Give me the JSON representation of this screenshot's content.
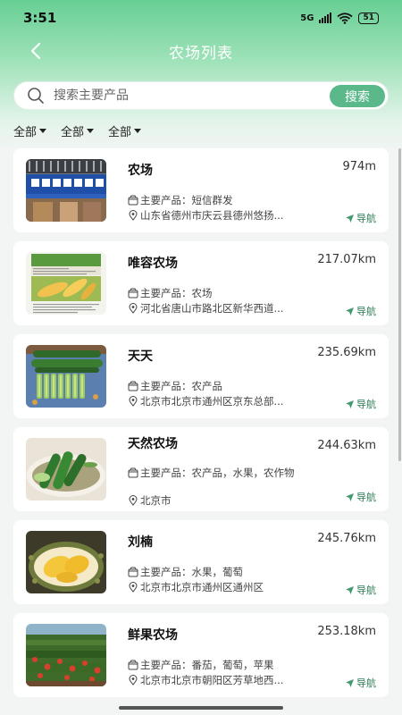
{
  "status": {
    "time": "3:51",
    "network": "5G",
    "battery": "51"
  },
  "nav": {
    "title": "农场列表"
  },
  "search": {
    "placeholder": "搜索主要产品",
    "button_label": "搜索"
  },
  "filters": [
    {
      "label": "全部"
    },
    {
      "label": "全部"
    },
    {
      "label": "全部"
    }
  ],
  "farms": [
    {
      "name": "农场",
      "distance": "974m",
      "product_label": "主要产品：",
      "products": "短信群发",
      "address": "山东省德州市庆云县德州悠扬...",
      "nav_label": "导航",
      "thumb": "building-sign"
    },
    {
      "name": "唯容农场",
      "distance": "217.07km",
      "product_label": "主要产品：",
      "products": "农场",
      "address": "河北省唐山市路北区新华西道...",
      "nav_label": "导航",
      "thumb": "corn-document"
    },
    {
      "name": "天天",
      "distance": "235.69km",
      "product_label": "主要产品：",
      "products": "农产品",
      "address": "北京市北京市通州区京东总部...",
      "nav_label": "导航",
      "thumb": "cucumbers"
    },
    {
      "name": "天然农场",
      "distance": "244.63km",
      "product_label": "主要产品：",
      "products": "农产品，水果，农作物",
      "address": "北京市",
      "nav_label": "导航",
      "thumb": "cucumber-plate"
    },
    {
      "name": "刘楠",
      "distance": "245.76km",
      "product_label": "主要产品：",
      "products": "水果，葡萄",
      "address": "北京市北京市通州区通州区",
      "nav_label": "导航",
      "thumb": "durian"
    },
    {
      "name": "鲜果农场",
      "distance": "253.18km",
      "product_label": "主要产品：",
      "products": "番茄，葡萄，苹果",
      "address": "北京市北京市朝阳区芳草地西...",
      "nav_label": "导航",
      "thumb": "tomato-field"
    }
  ],
  "colors": {
    "accent": "#5ab88a",
    "header_top": "#67cf94",
    "nav_icon": "#2a7d56"
  }
}
